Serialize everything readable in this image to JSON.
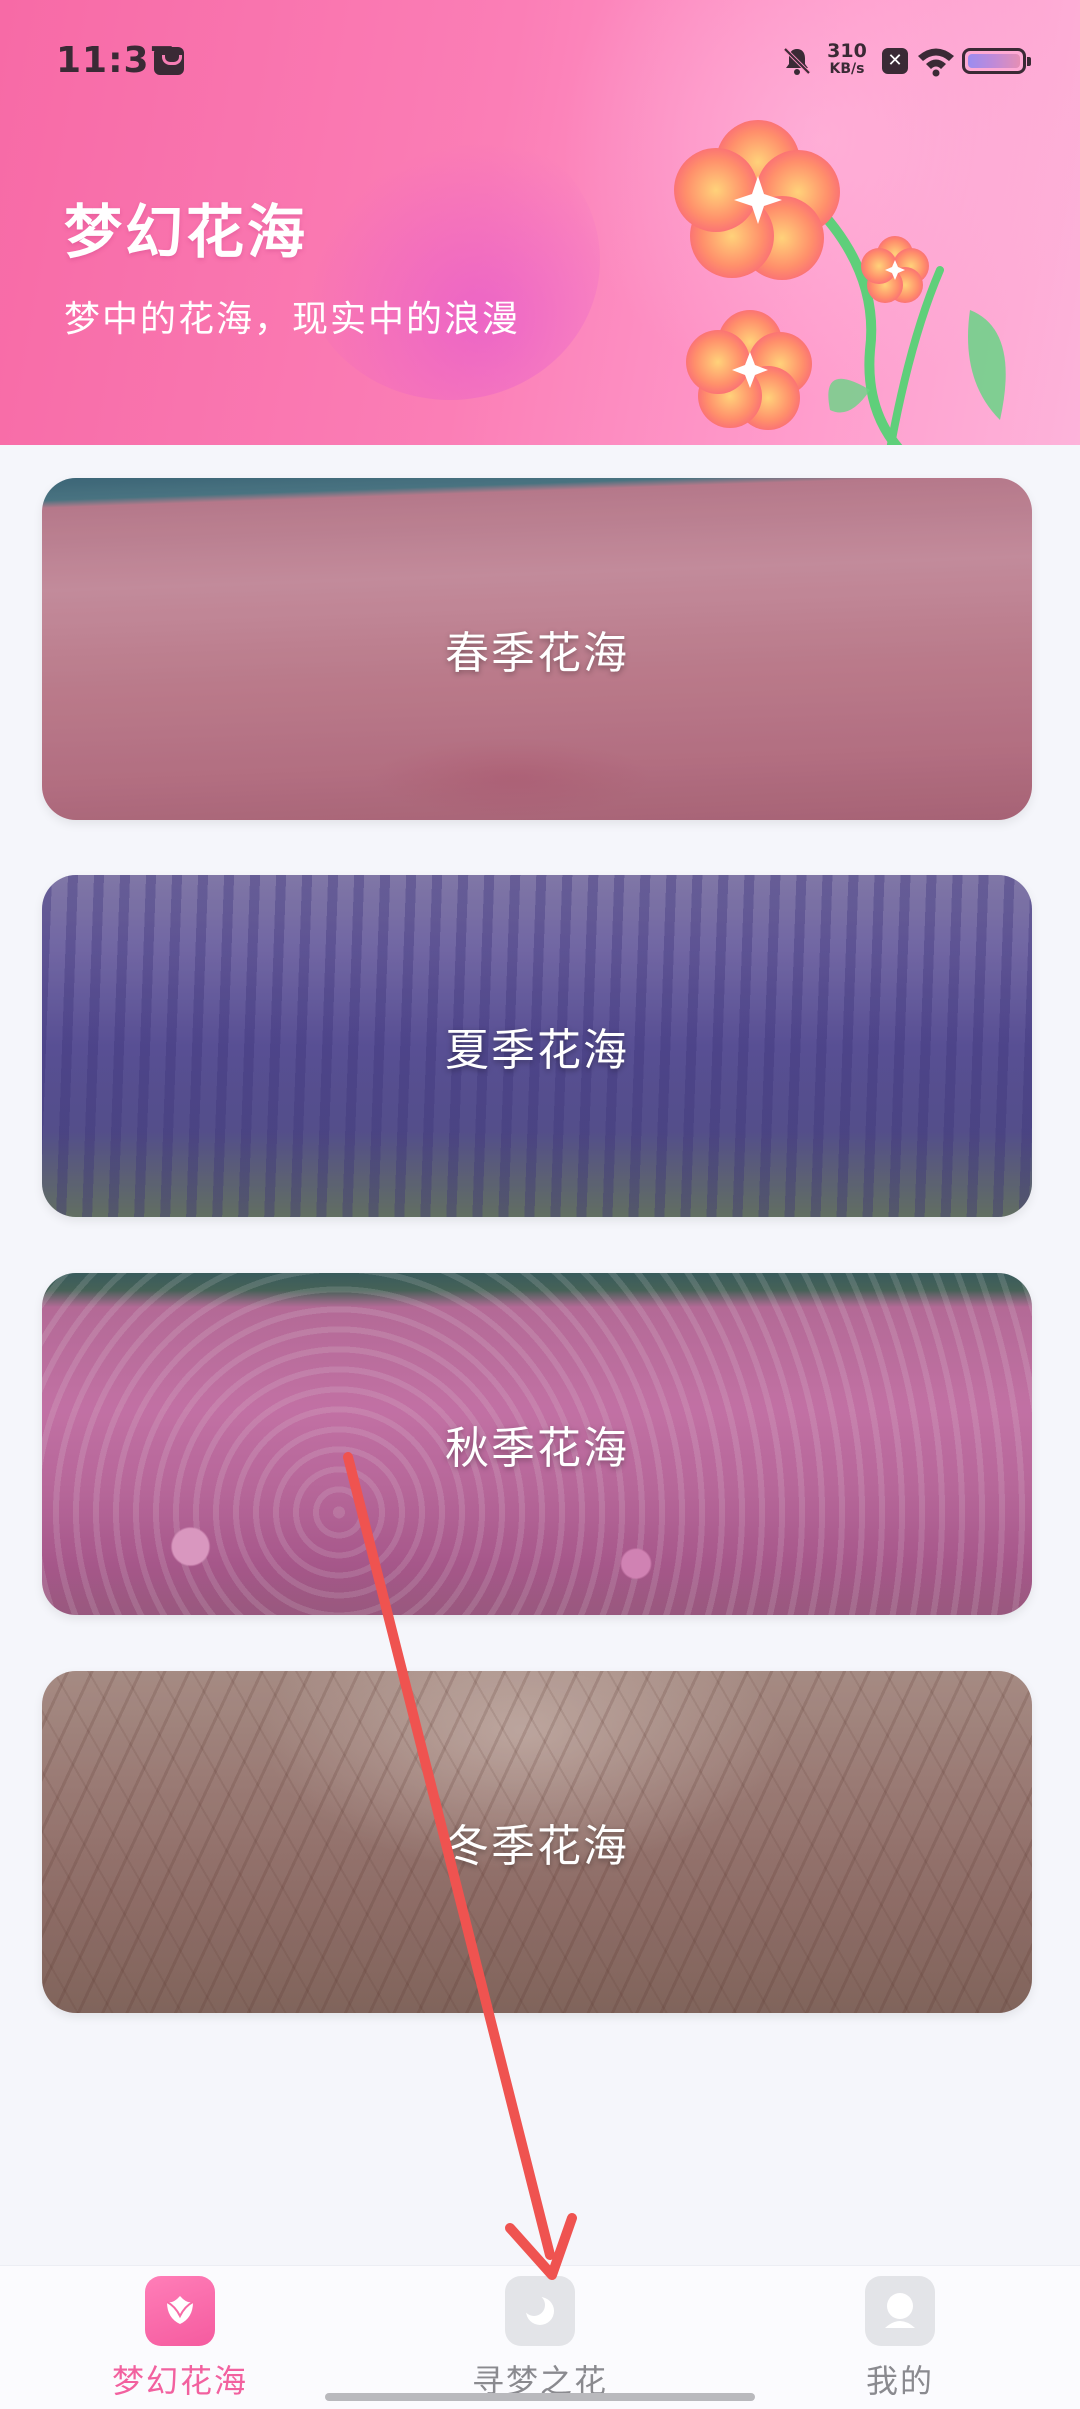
{
  "status_bar": {
    "time": "11:37",
    "net_speed_value": "310",
    "net_speed_unit": "KB/s",
    "icons": [
      "app-notification-icon",
      "mute-icon",
      "close-box-icon",
      "wifi-icon",
      "battery-icon"
    ]
  },
  "header": {
    "title": "梦幻花海",
    "subtitle": "梦中的花海，现实中的浪漫"
  },
  "cards": [
    {
      "label": "春季花海"
    },
    {
      "label": "夏季花海"
    },
    {
      "label": "秋季花海"
    },
    {
      "label": "冬季花海"
    }
  ],
  "bottom_nav": {
    "items": [
      {
        "label": "梦幻花海",
        "icon": "flower-icon",
        "active": true
      },
      {
        "label": "寻梦之花",
        "icon": "moon-icon",
        "active": false
      },
      {
        "label": "我的",
        "icon": "profile-icon",
        "active": false
      }
    ]
  },
  "colors": {
    "accent": "#f2619f",
    "header_gradient_start": "#f76aa6",
    "header_gradient_end": "#fdb3da",
    "annotation_arrow": "#ef5350"
  }
}
